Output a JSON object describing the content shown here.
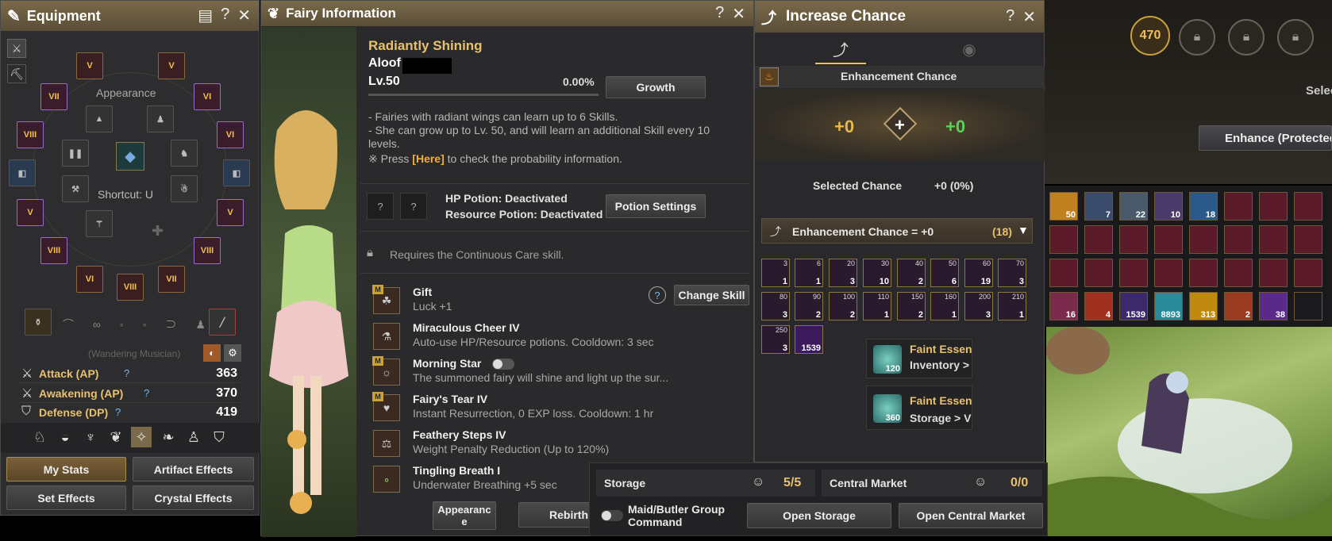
{
  "equipment": {
    "title": "Equipment",
    "appearance_label": "Appearance",
    "shortcut_label": "Shortcut: U",
    "wandering_text": "(Wandering Musician)",
    "stats": [
      {
        "label": "Attack (AP)",
        "help": "?",
        "value": "363"
      },
      {
        "label": "Awakening (AP)",
        "help": "?",
        "value": "370"
      },
      {
        "label": "Defense (DP)",
        "help": "?",
        "value": "419"
      }
    ],
    "buttons": {
      "my_stats": "My Stats",
      "artifact_effects": "Artifact Effects",
      "set_effects": "Set Effects",
      "crystal_effects": "Crystal Effects"
    },
    "slot_grades": [
      "V",
      "V",
      "VII",
      "VI",
      "VIII",
      "VI",
      "V",
      "V",
      "VIII",
      "VIII",
      "VI",
      "VIII",
      "VII"
    ]
  },
  "fairy": {
    "title": "Fairy Information",
    "tier": "Radiantly Shining",
    "name": "Aloof",
    "level": "Lv.50",
    "progress_text": "0.00%",
    "progress": 0,
    "growth_button": "Growth",
    "notes": [
      "- Fairies with radiant wings can learn up to 6 Skills.",
      "- She can grow up to Lv. 50, and will learn an additional Skill every 10",
      "levels."
    ],
    "press_prefix": "※ Press",
    "press_link": "[Here]",
    "press_suffix": "to check the probability information.",
    "potion_slot": "?",
    "hp_potion": "HP Potion: Deactivated",
    "resource_potion": "Resource Potion: Deactivated",
    "potion_settings_button": "Potion Settings",
    "continuous_care": "Requires the Continuous Care skill.",
    "help_icon": "?",
    "change_skill_button": "Change Skill",
    "m_badge": "M",
    "skills": [
      {
        "name": "Gift",
        "desc": "Luck +1",
        "badge": true
      },
      {
        "name": "Miraculous Cheer IV",
        "desc": "Auto-use HP/Resource potions. Cooldown: 3 sec",
        "badge": false
      },
      {
        "name": "Morning Star",
        "desc": "The summoned fairy will shine and light up the sur...",
        "badge": true
      },
      {
        "name": "Fairy's Tear IV",
        "desc": "Instant Resurrection, 0 EXP loss. Cooldown: 1 hr",
        "badge": true
      },
      {
        "name": "Feathery Steps IV",
        "desc": "Weight Penalty Reduction (Up to 120%)",
        "badge": false
      },
      {
        "name": "Tingling Breath I",
        "desc": "Underwater Breathing +5 sec",
        "badge": false
      }
    ],
    "appearance_button": "Appearanc e",
    "rebirth_button": "Rebirth"
  },
  "increase_chance": {
    "title": "Increase Chance",
    "enhancement_chance_label": "Enhancement Chance",
    "left_value": "+0",
    "plus_symbol": "+",
    "right_value": "+0",
    "selected_chance_label": "Selected Chance",
    "selected_chance_value": "+0 (0%)",
    "dropdown_label": "Enhancement Chance = +0",
    "dropdown_count": "(18)",
    "items": [
      {
        "tl": "3",
        "count": "1"
      },
      {
        "tl": "6",
        "count": "1"
      },
      {
        "tl": "20",
        "count": "3"
      },
      {
        "tl": "30",
        "count": "10"
      },
      {
        "tl": "40",
        "count": "2"
      },
      {
        "tl": "50",
        "count": "6"
      },
      {
        "tl": "60",
        "count": "19"
      },
      {
        "tl": "70",
        "count": "3"
      },
      {
        "tl": "80",
        "count": "3"
      },
      {
        "tl": "90",
        "count": "2"
      },
      {
        "tl": "100",
        "count": "2"
      },
      {
        "tl": "110",
        "count": "1"
      },
      {
        "tl": "150",
        "count": "2"
      },
      {
        "tl": "160",
        "count": "1"
      },
      {
        "tl": "200",
        "count": "3"
      },
      {
        "tl": "210",
        "count": "1"
      },
      {
        "tl": "250",
        "count": "3"
      },
      {
        "tl": "",
        "count": "1539"
      }
    ],
    "faint_essence": [
      {
        "count": "120",
        "title": "Faint Essen",
        "sub": "Inventory >"
      },
      {
        "count": "360",
        "title": "Faint Essen",
        "sub": "Storage > V"
      }
    ]
  },
  "storage_bar": {
    "storage_label": "Storage",
    "storage_value": "5/5",
    "market_label": "Central Market",
    "market_value": "0/0",
    "maid_toggle_label": "Maid/Butler Group Command",
    "open_storage": "Open Storage",
    "open_market": "Open Central Market"
  },
  "enhance_right": {
    "level_badge": "470",
    "select_text": "Selec",
    "enhance_button": "Enhance (Protected",
    "inventory_counts": [
      "50",
      "7",
      "22",
      "10",
      "18",
      "",
      "",
      "",
      "",
      "",
      "",
      "",
      "",
      "",
      "",
      "",
      "",
      "",
      "",
      "",
      "",
      "",
      "",
      "",
      "16",
      "4",
      "1539",
      "8893",
      "313",
      "2",
      "38",
      ""
    ]
  }
}
